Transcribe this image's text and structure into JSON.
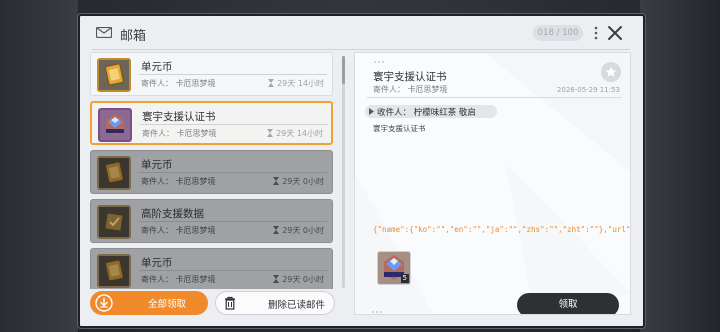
{
  "window": {
    "title": "邮箱",
    "capacity": "018 / 100"
  },
  "mails": [
    {
      "title": "单元币",
      "sender": "寄件人： 卡厄思梦境",
      "time_left": "29天 14小时",
      "state": "unread",
      "icon": "gold-card-icon"
    },
    {
      "title": "寰宇支援认证书",
      "sender": "寄件人： 卡厄思梦境",
      "time_left": "29天 14小时",
      "state": "selected",
      "icon": "blue-gem-crest-icon"
    },
    {
      "title": "单元币",
      "sender": "寄件人： 卡厄思梦境",
      "time_left": "29天 0小时",
      "state": "read",
      "icon": "gold-card-icon"
    },
    {
      "title": "高阶支援数据",
      "sender": "寄件人： 卡厄思梦境",
      "time_left": "29天 0小时",
      "state": "read",
      "icon": "data-chip-icon"
    },
    {
      "title": "单元币",
      "sender": "寄件人： 卡厄思梦境",
      "time_left": "29天 0小时",
      "state": "read",
      "icon": "gold-card-icon"
    }
  ],
  "buttons": {
    "claim_all": "全部领取",
    "delete_read": "删除已读邮件",
    "claim": "领取"
  },
  "detail": {
    "title": "寰宇支援认证书",
    "sender": "寄件人： 卡厄思梦境",
    "date": "2026-05-29 11:53",
    "recipient": "收件人： 柠檬味红茶 敬启",
    "body": "寰宇支援认证书",
    "raw_json": "{\"name\":{\"ko\":\"\",\"en\":\"\",\"ja\":\"\",\"zhs\":\"\",\"zht\":\"\"},\"url\":{\"ko\":\"\",\"en\":\"\",\"ja\":\"\",\"zhs\":\"\"",
    "attachment": {
      "icon": "blue-gem-crest-icon",
      "quantity": "5"
    }
  },
  "colors": {
    "accent": "#f08a2b",
    "selected_border": "#f0a334",
    "raw_json_text": "#ef8a2a",
    "dark_button": "#2f3033"
  }
}
